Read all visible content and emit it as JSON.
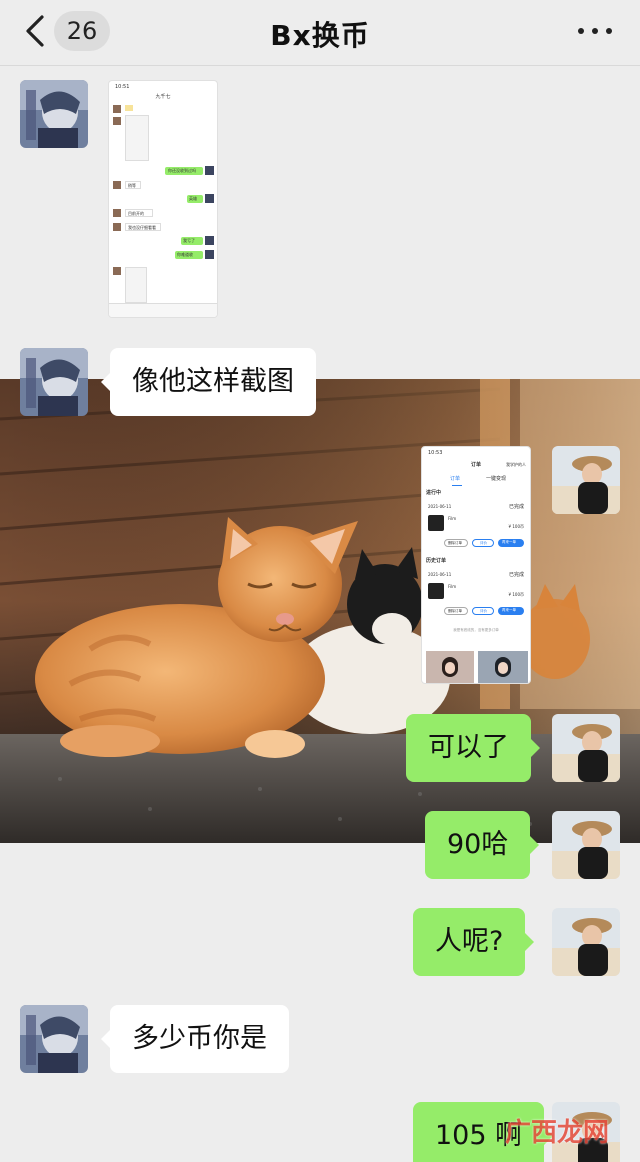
{
  "header": {
    "unread_count": "26",
    "title": "Bx换币"
  },
  "messages": [
    {
      "side": "left",
      "kind": "image",
      "desc_icon": "chat-screenshot"
    },
    {
      "side": "left",
      "kind": "text",
      "text": "像他这样截图"
    },
    {
      "side": "right",
      "kind": "image",
      "desc_icon": "order-screenshot"
    },
    {
      "side": "right",
      "kind": "text",
      "text": "可以了"
    },
    {
      "side": "right",
      "kind": "text",
      "text": "90哈"
    },
    {
      "side": "right",
      "kind": "text",
      "text": "人呢?"
    },
    {
      "side": "left",
      "kind": "text",
      "text": "多少币你是"
    },
    {
      "side": "right",
      "kind": "text",
      "text": "105 啊"
    }
  ],
  "thumb1": {
    "status_time": "10:51",
    "title": "九千七",
    "lines": [
      "你还没收到过吗",
      "稍等",
      "英雄",
      "目前开的",
      "我也没仔细看看",
      "我亏了",
      "你难道收"
    ]
  },
  "thumb2": {
    "status_time": "10:53",
    "title": "订单",
    "right_tab": "我学护的人",
    "tabs": [
      "订单",
      "一键变现"
    ],
    "section1": "进行中",
    "date1": "2021-06-11",
    "status1": "已完成",
    "item_name": "Film",
    "price": "¥ 100币",
    "section2": "历史订单",
    "date2": "2021-06-11",
    "status2": "已完成",
    "btn_cancel": "删除订单",
    "btn_rate": "评价",
    "btn_again": "再来一单",
    "footer": "我是有底线的，没有更多订单"
  },
  "watermark": "广西龙网",
  "colors": {
    "background": "#ededed",
    "bubble_right": "#95ec69",
    "bubble_left": "#ffffff",
    "accent_blue": "#2a7ff0"
  }
}
